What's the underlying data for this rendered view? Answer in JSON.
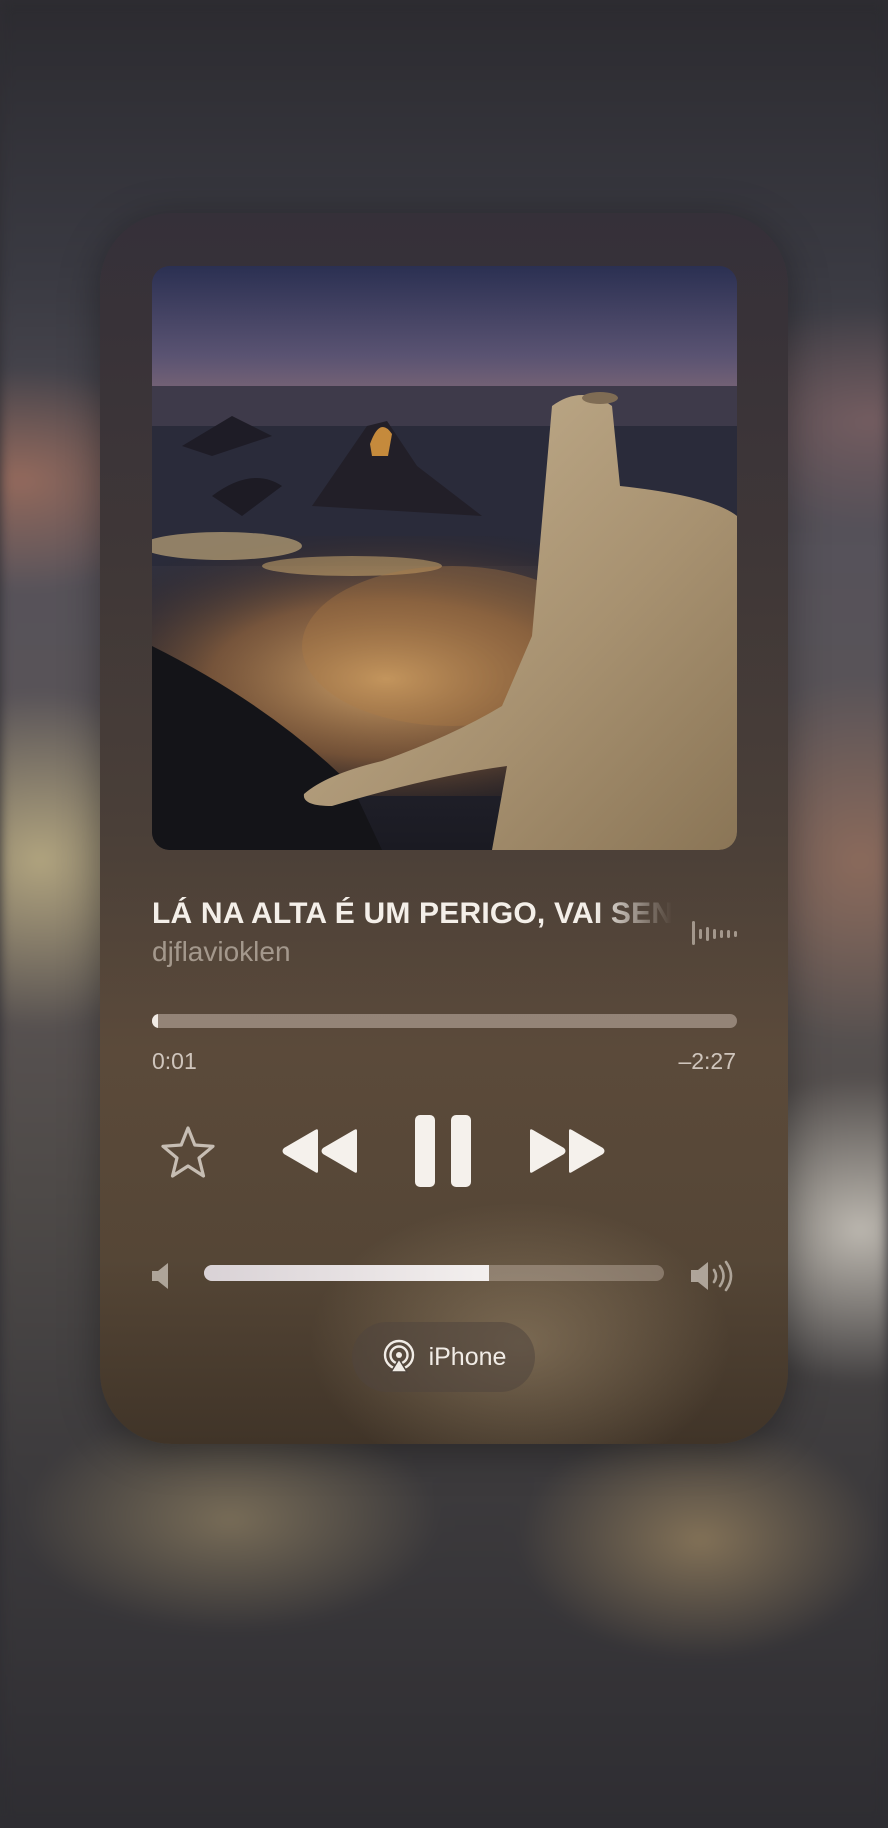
{
  "now_playing": {
    "title": "LÁ NA ALTA É UM PERIGO, VAI SENTANDO",
    "artist": "djflavioklen",
    "elapsed": "0:01",
    "remaining": "–2:27",
    "progress_fraction": 0.01
  },
  "controls": {
    "favorite_icon": "star-icon",
    "rewind_icon": "rewind-icon",
    "play_state_icon": "pause-icon",
    "fast_forward_icon": "fast-forward-icon"
  },
  "volume": {
    "level_fraction": 0.62,
    "low_icon": "speaker-low-icon",
    "high_icon": "speaker-high-icon"
  },
  "output": {
    "icon": "airplay-icon",
    "device_label": "iPhone"
  },
  "colors": {
    "foreground": "#f4efe9",
    "track": "#d8ccc3"
  }
}
